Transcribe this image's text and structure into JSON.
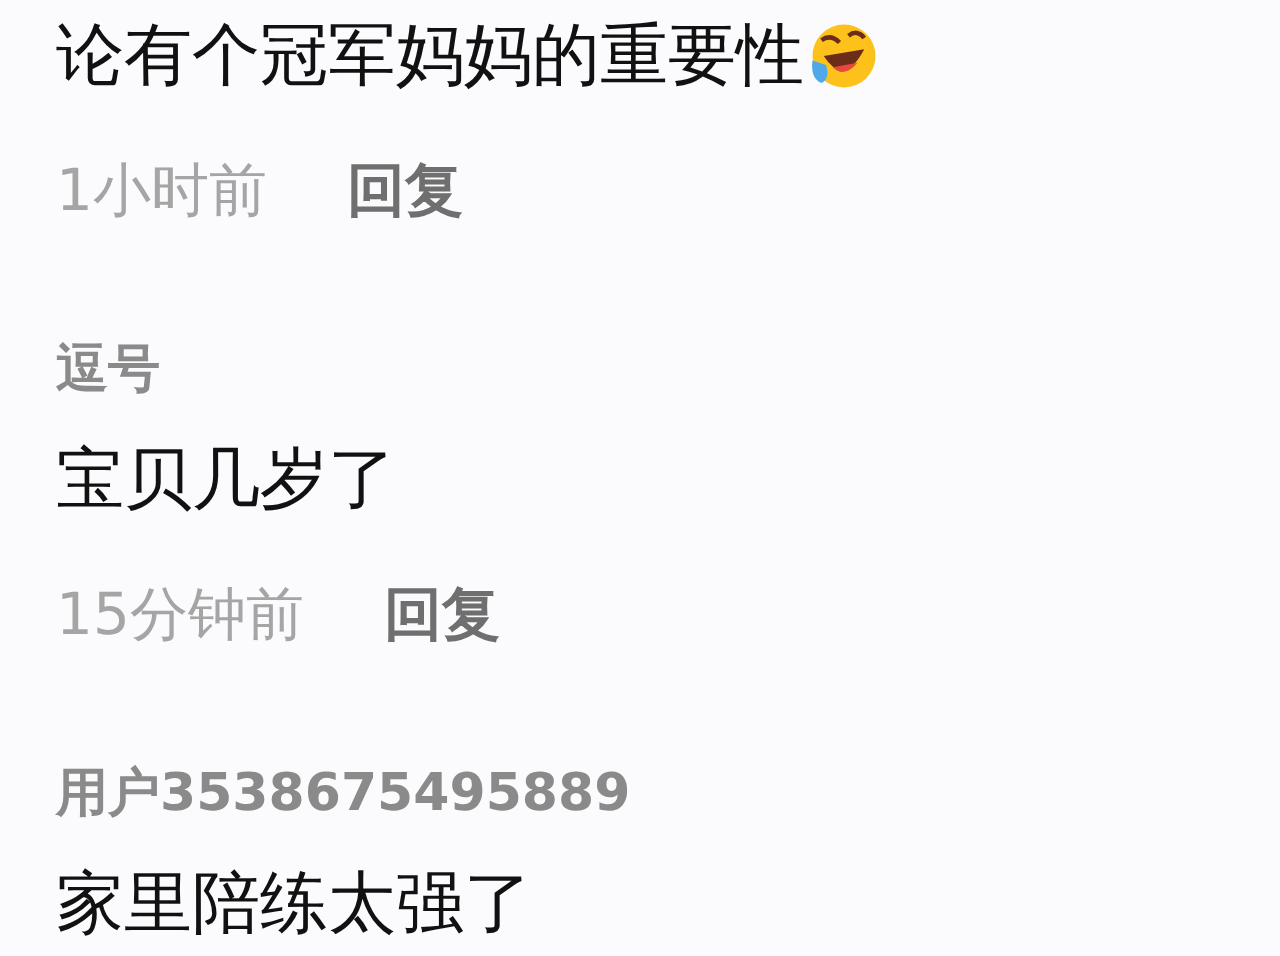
{
  "comments": [
    {
      "text": "论有个冠军妈妈的重要性",
      "emoji": {
        "kind": "laughing-crying"
      },
      "time": "1小时前",
      "reply": "回复"
    },
    {
      "username": "逗号",
      "text": "宝贝几岁了",
      "time": "15分钟前",
      "reply": "回复"
    },
    {
      "username": "用户3538675495889",
      "text": "家里陪练太强了"
    }
  ]
}
